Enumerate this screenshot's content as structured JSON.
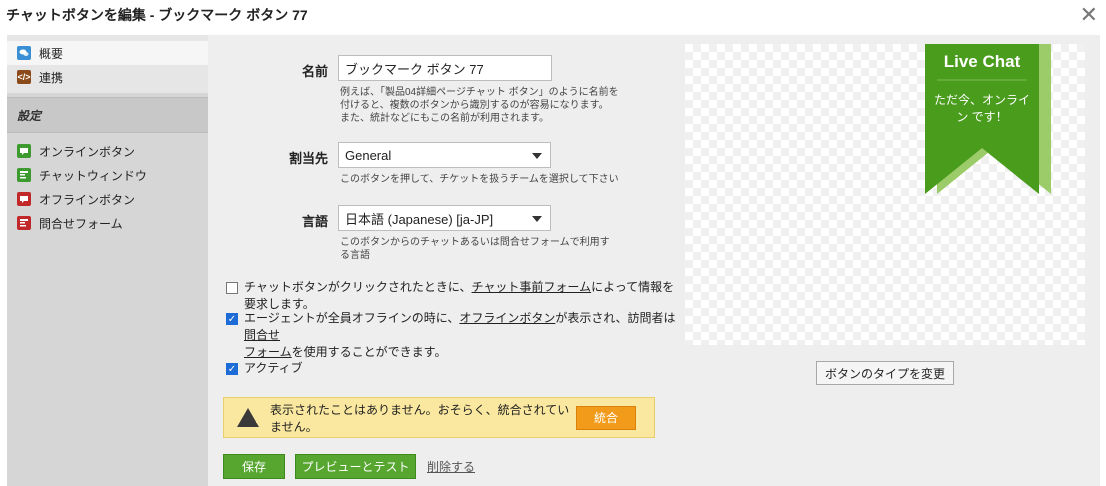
{
  "dialog": {
    "title": "チャットボタンを編集 - ブックマーク ボタン 77",
    "close_symbol": "✕"
  },
  "sidebar": {
    "top_items": [
      {
        "label": "概要",
        "icon": "overview-icon",
        "color": "#3a8fd4"
      },
      {
        "label": "連携",
        "icon": "code-icon",
        "color": "#8b4a1a"
      }
    ],
    "section_title": "設定",
    "items": [
      {
        "label": "オンラインボタン",
        "icon": "online-button-icon",
        "color": "#3c9a2e"
      },
      {
        "label": "チャットウィンドウ",
        "icon": "chat-window-icon",
        "color": "#3c9a2e"
      },
      {
        "label": "オフラインボタン",
        "icon": "offline-button-icon",
        "color": "#c0282a"
      },
      {
        "label": "問合せフォーム",
        "icon": "contact-form-icon",
        "color": "#c0282a"
      }
    ]
  },
  "form": {
    "name": {
      "label": "名前",
      "value": "ブックマーク ボタン 77",
      "help_lines": [
        "例えば、「製品04詳細ページチャット ボタン」のように名前を",
        "付けると、複数のボタンから識別するのが容易になります。",
        "また、統計などにもこの名前が利用されます。"
      ]
    },
    "assign": {
      "label": "割当先",
      "value": "General",
      "help_lines": [
        "このボタンを押して、チケットを扱うチームを選択して下さい"
      ]
    },
    "language": {
      "label": "言語",
      "value": "日本語 (Japanese) [ja-JP]",
      "help_lines": [
        "このボタンからのチャットあるいは問合せフォームで利用す",
        "る言語"
      ]
    },
    "prechat": {
      "checked": false,
      "text_before": "チャットボタンがクリックされたときに、",
      "link": "チャット事前フォーム",
      "text_after": "によって情報を要求します。"
    },
    "offline": {
      "checked": true,
      "text1": "エージェントが全員オフラインの時に、",
      "link1": "オフラインボタン",
      "text2": "が表示され、訪問者は",
      "link2_part1": "問合せ",
      "link2_part2": "フォーム",
      "text3": "を使用することができます。"
    },
    "active": {
      "checked": true,
      "label": "アクティブ"
    }
  },
  "preview": {
    "title": "Live Chat",
    "subtitle": "ただ今、オンライン です！",
    "ribbon_color": "#4a9c1d",
    "ribbon_shadow": "#9ccc6a"
  },
  "change_type_button": "ボタンのタイプを変更",
  "warning": {
    "message": "表示されたことはありません。おそらく、統合されていません。",
    "action": "統合",
    "icon_symbol": "!"
  },
  "actions": {
    "save": "保存",
    "preview_test": "プレビューとテスト",
    "delete": "削除する"
  }
}
